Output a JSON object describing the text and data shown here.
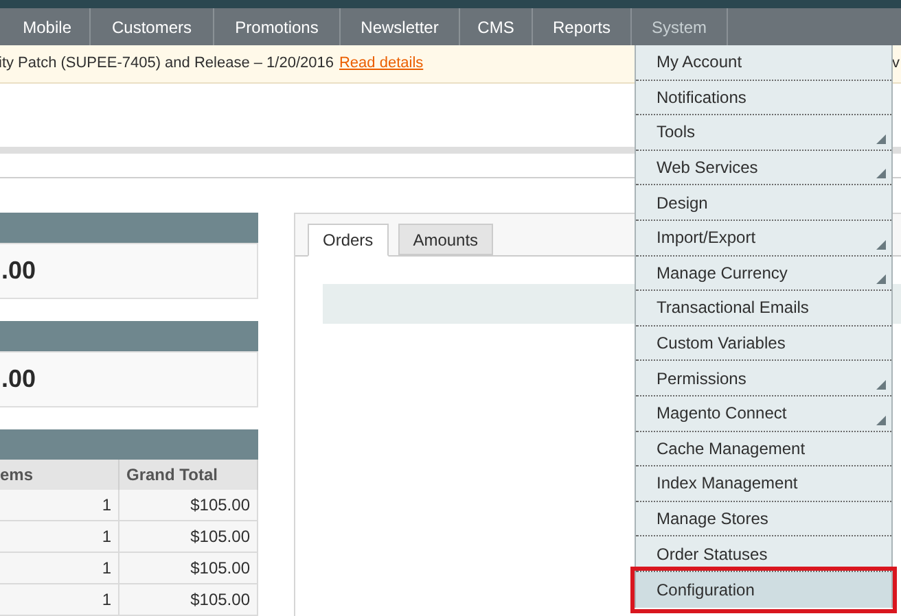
{
  "nav": [
    {
      "label": "Mobile",
      "selected": false
    },
    {
      "label": "Customers",
      "selected": false
    },
    {
      "label": "Promotions",
      "selected": false
    },
    {
      "label": "Newsletter",
      "selected": false
    },
    {
      "label": "CMS",
      "selected": false
    },
    {
      "label": "Reports",
      "selected": false
    },
    {
      "label": "System",
      "selected": true
    }
  ],
  "notice": {
    "text": "ity Patch (SUPEE-7405) and Release – 1/20/2016",
    "link": "Read details",
    "tail": "v"
  },
  "stats": [
    {
      "value": ".00"
    },
    {
      "value": ".00"
    }
  ],
  "table": {
    "columns": [
      "ems",
      "Grand Total"
    ],
    "rows": [
      [
        "1",
        "$105.00"
      ],
      [
        "1",
        "$105.00"
      ],
      [
        "1",
        "$105.00"
      ],
      [
        "1",
        "$105.00"
      ]
    ]
  },
  "chart_tabs": [
    {
      "label": "Orders",
      "selected": true
    },
    {
      "label": "Amounts",
      "selected": false
    }
  ],
  "menu": [
    {
      "label": "My Account",
      "submenu": false,
      "selected": false
    },
    {
      "label": "Notifications",
      "submenu": false,
      "selected": false
    },
    {
      "label": "Tools",
      "submenu": true,
      "selected": false
    },
    {
      "label": "Web Services",
      "submenu": true,
      "selected": false
    },
    {
      "label": "Design",
      "submenu": false,
      "selected": false
    },
    {
      "label": "Import/Export",
      "submenu": true,
      "selected": false
    },
    {
      "label": "Manage Currency",
      "submenu": true,
      "selected": false
    },
    {
      "label": "Transactional Emails",
      "submenu": false,
      "selected": false
    },
    {
      "label": "Custom Variables",
      "submenu": false,
      "selected": false
    },
    {
      "label": "Permissions",
      "submenu": true,
      "selected": false
    },
    {
      "label": "Magento Connect",
      "submenu": true,
      "selected": false
    },
    {
      "label": "Cache Management",
      "submenu": false,
      "selected": false
    },
    {
      "label": "Index Management",
      "submenu": false,
      "selected": false
    },
    {
      "label": "Manage Stores",
      "submenu": false,
      "selected": false
    },
    {
      "label": "Order Statuses",
      "submenu": false,
      "selected": false
    },
    {
      "label": "Configuration",
      "submenu": false,
      "selected": true
    }
  ]
}
